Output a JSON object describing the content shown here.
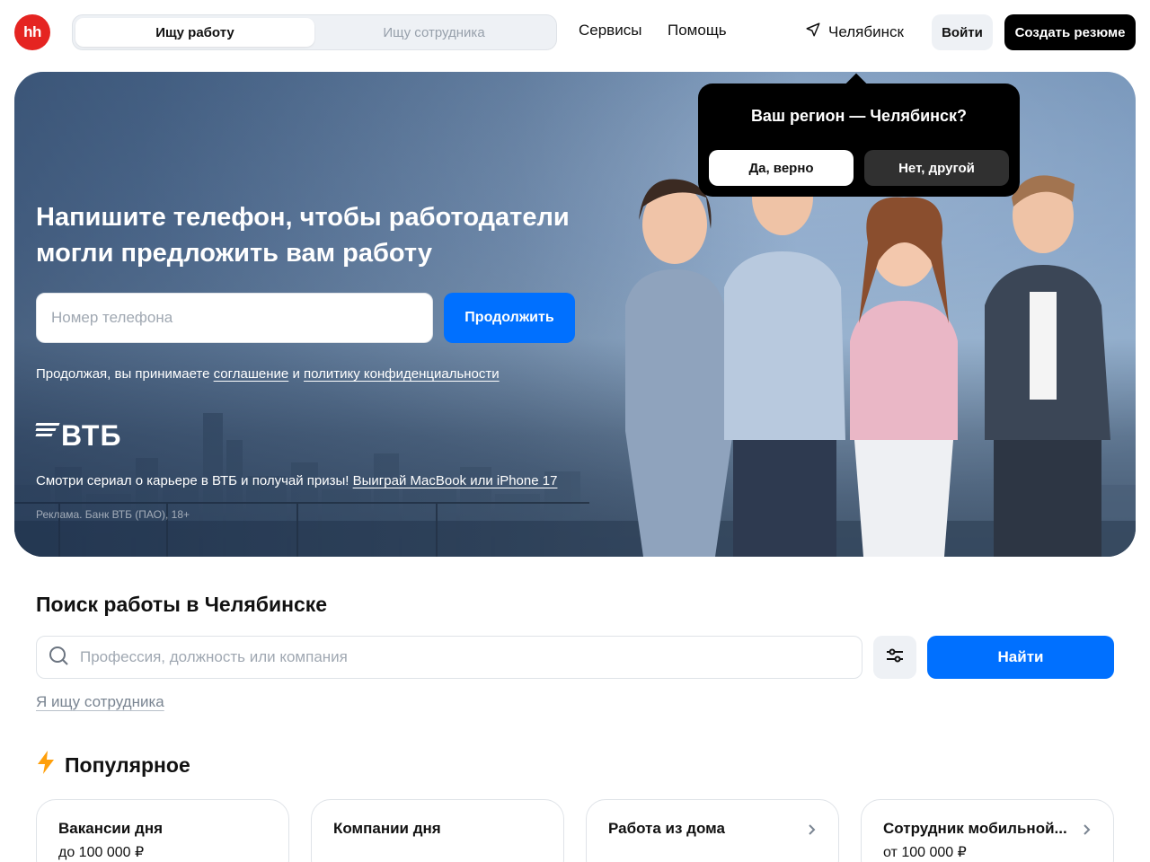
{
  "header": {
    "logo_text": "hh",
    "role_tabs": [
      {
        "label": "Ищу работу",
        "active": true
      },
      {
        "label": "Ищу сотрудника",
        "active": false
      }
    ],
    "nav": [
      "Сервисы",
      "Помощь"
    ],
    "city": "Челябинск",
    "login_label": "Войти",
    "create_resume_label": "Создать резюме"
  },
  "hero": {
    "title": "Напишите телефон, чтобы работодатели могли предложить вам работу",
    "phone_placeholder": "Номер телефона",
    "phone_value": "",
    "continue_label": "Продолжить",
    "consent_prefix": "Продолжая, вы принимаете",
    "consent_link_agreement": "соглашение",
    "consent_and": "и",
    "consent_link_privacy": "политику конфиденциальности",
    "brand_logo": "ВТБ",
    "promo_text": "Смотри сериал о карьере в ВТБ и получай призы!",
    "promo_link": "Выиграй MacBook или iPhone 17",
    "ad_label": "Реклама. Банк ВТБ (ПАО), 18+"
  },
  "region_popup": {
    "title": "Ваш регион — Челябинск?",
    "yes_label": "Да, верно",
    "no_label": "Нет, другой"
  },
  "search": {
    "title": "Поиск работы в Челябинске",
    "placeholder": "Профессия, должность или компания",
    "value": "",
    "find_label": "Найти",
    "employer_link": "Я ищу сотрудника"
  },
  "popular": {
    "title": "Популярное",
    "cards": [
      {
        "title": "Вакансии дня",
        "subtitle": "до 100 000 ₽",
        "chevron": false
      },
      {
        "title": "Компании дня",
        "subtitle": "",
        "chevron": false
      },
      {
        "title": "Работа из дома",
        "subtitle": "",
        "chevron": true
      },
      {
        "title": "Сотрудник мобильной...",
        "subtitle": "от 100 000 ₽",
        "chevron": true
      }
    ]
  },
  "colors": {
    "brand_red": "#e52421",
    "primary_blue": "#0070ff",
    "accent_orange": "#ff9f0a",
    "black": "#000000"
  }
}
